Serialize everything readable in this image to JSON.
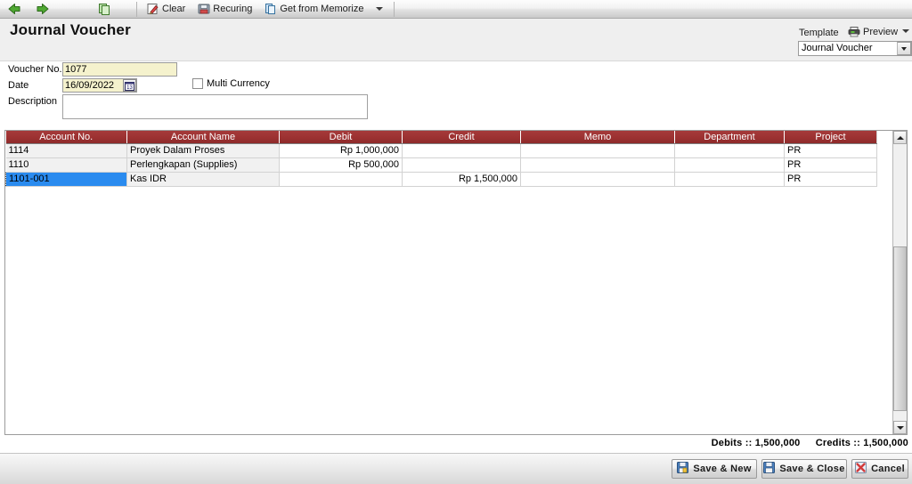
{
  "toolbar": {
    "back_icon": "back-arrow-icon",
    "forward_icon": "forward-arrow-icon",
    "copy_icon": "copy-icon",
    "clear_label": "Clear",
    "recurring_label": "Recuring",
    "memorize_label": "Get from Memorize",
    "memorize_caret": "chevron-down-icon"
  },
  "header": {
    "title": "Journal Voucher",
    "template_label": "Template",
    "preview_label": "Preview",
    "template_value": "Journal Voucher"
  },
  "form": {
    "voucher_label": "Voucher No.",
    "voucher_value": "1077",
    "date_label": "Date",
    "date_value": "16/09/2022",
    "description_label": "Description",
    "description_value": "",
    "description_placeholder": "",
    "multi_currency_label": "Multi Currency",
    "multi_currency_checked": false
  },
  "grid": {
    "columns": [
      "Account No.",
      "Account Name",
      "Debit",
      "Credit",
      "Memo",
      "Department",
      "Project"
    ],
    "rows": [
      {
        "account_no": "1114",
        "account_name": "Proyek Dalam Proses",
        "debit": "Rp 1,000,000",
        "credit": "",
        "memo": "",
        "department": "",
        "project": "PR",
        "selected": false
      },
      {
        "account_no": "1110",
        "account_name": "Perlengkapan (Supplies)",
        "debit": "Rp 500,000",
        "credit": "",
        "memo": "",
        "department": "",
        "project": "PR",
        "selected": false
      },
      {
        "account_no": "1101-001",
        "account_name": "Kas IDR",
        "debit": "",
        "credit": "Rp 1,500,000",
        "memo": "",
        "department": "",
        "project": "PR",
        "selected": true
      }
    ]
  },
  "totals": {
    "debits": "Debits :: 1,500,000",
    "credits": "Credits :: 1,500,000"
  },
  "footer": {
    "save_new_label": "Save & New",
    "save_close_label": "Save & Close",
    "cancel_label": "Cancel"
  },
  "colors": {
    "header_red": "#9d3232",
    "selection_blue": "#2a8bef",
    "field_yellow": "#f5f2cd",
    "accent_green": "#4c9a2a"
  }
}
